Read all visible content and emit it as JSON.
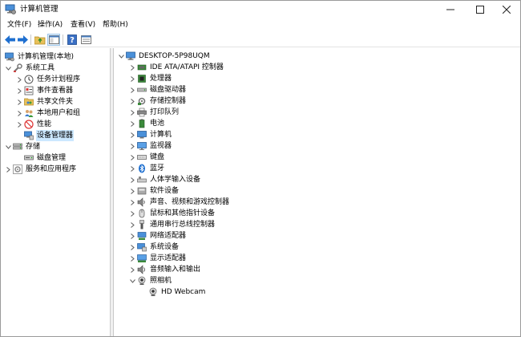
{
  "window": {
    "title": "计算机管理",
    "controls": {
      "minimize": "—",
      "maximize": "☐",
      "close": "✕"
    }
  },
  "menu": [
    {
      "label": "文件(F)"
    },
    {
      "label": "操作(A)"
    },
    {
      "label": "查看(V)"
    },
    {
      "label": "帮助(H)"
    }
  ],
  "toolbar": {
    "buttons": [
      "back-arrow-icon",
      "forward-arrow-icon",
      "up-folder-icon",
      "show-hide-tree-icon",
      "help-icon",
      "properties-icon"
    ]
  },
  "left_tree": [
    {
      "label": "计算机管理(本地)",
      "level": 0,
      "expander": "none",
      "icon": "computer-management-icon"
    },
    {
      "label": "系统工具",
      "level": 1,
      "expander": "expanded",
      "icon": "system-tools-icon"
    },
    {
      "label": "任务计划程序",
      "level": 2,
      "expander": "collapsed",
      "icon": "task-scheduler-icon"
    },
    {
      "label": "事件查看器",
      "level": 2,
      "expander": "collapsed",
      "icon": "event-viewer-icon"
    },
    {
      "label": "共享文件夹",
      "level": 2,
      "expander": "collapsed",
      "icon": "shared-folders-icon"
    },
    {
      "label": "本地用户和组",
      "level": 2,
      "expander": "collapsed",
      "icon": "local-users-icon"
    },
    {
      "label": "性能",
      "level": 2,
      "expander": "collapsed",
      "icon": "performance-icon"
    },
    {
      "label": "设备管理器",
      "level": 2,
      "expander": "none",
      "icon": "device-manager-icon",
      "selected": true
    },
    {
      "label": "存储",
      "level": 1,
      "expander": "expanded",
      "icon": "storage-icon"
    },
    {
      "label": "磁盘管理",
      "level": 2,
      "expander": "none",
      "icon": "disk-management-icon"
    },
    {
      "label": "服务和应用程序",
      "level": 1,
      "expander": "collapsed",
      "icon": "services-apps-icon"
    }
  ],
  "device_tree": {
    "root": "DESKTOP-5P98UQM",
    "categories": [
      {
        "label": "IDE ATA/ATAPI 控制器",
        "icon": "ide-controller-icon"
      },
      {
        "label": "处理器",
        "icon": "processor-icon"
      },
      {
        "label": "磁盘驱动器",
        "icon": "disk-drive-icon"
      },
      {
        "label": "存储控制器",
        "icon": "storage-controller-icon"
      },
      {
        "label": "打印队列",
        "icon": "print-queue-icon"
      },
      {
        "label": "电池",
        "icon": "battery-icon"
      },
      {
        "label": "计算机",
        "icon": "computer-icon"
      },
      {
        "label": "监视器",
        "icon": "monitor-icon"
      },
      {
        "label": "键盘",
        "icon": "keyboard-icon"
      },
      {
        "label": "蓝牙",
        "icon": "bluetooth-icon"
      },
      {
        "label": "人体学输入设备",
        "icon": "hid-icon"
      },
      {
        "label": "软件设备",
        "icon": "software-device-icon"
      },
      {
        "label": "声音、视频和游戏控制器",
        "icon": "sound-icon"
      },
      {
        "label": "鼠标和其他指针设备",
        "icon": "mouse-icon"
      },
      {
        "label": "通用串行总线控制器",
        "icon": "usb-icon"
      },
      {
        "label": "网络适配器",
        "icon": "network-adapter-icon"
      },
      {
        "label": "系统设备",
        "icon": "system-device-icon"
      },
      {
        "label": "显示适配器",
        "icon": "display-adapter-icon"
      },
      {
        "label": "音频输入和输出",
        "icon": "audio-io-icon"
      },
      {
        "label": "照相机",
        "icon": "camera-icon",
        "expanded": true,
        "children": [
          {
            "label": "HD Webcam",
            "icon": "webcam-icon"
          }
        ]
      }
    ]
  },
  "colors": {
    "selection": "#cce8ff",
    "accent": "#1e6fd0",
    "arrow": "#5b5b5b"
  }
}
